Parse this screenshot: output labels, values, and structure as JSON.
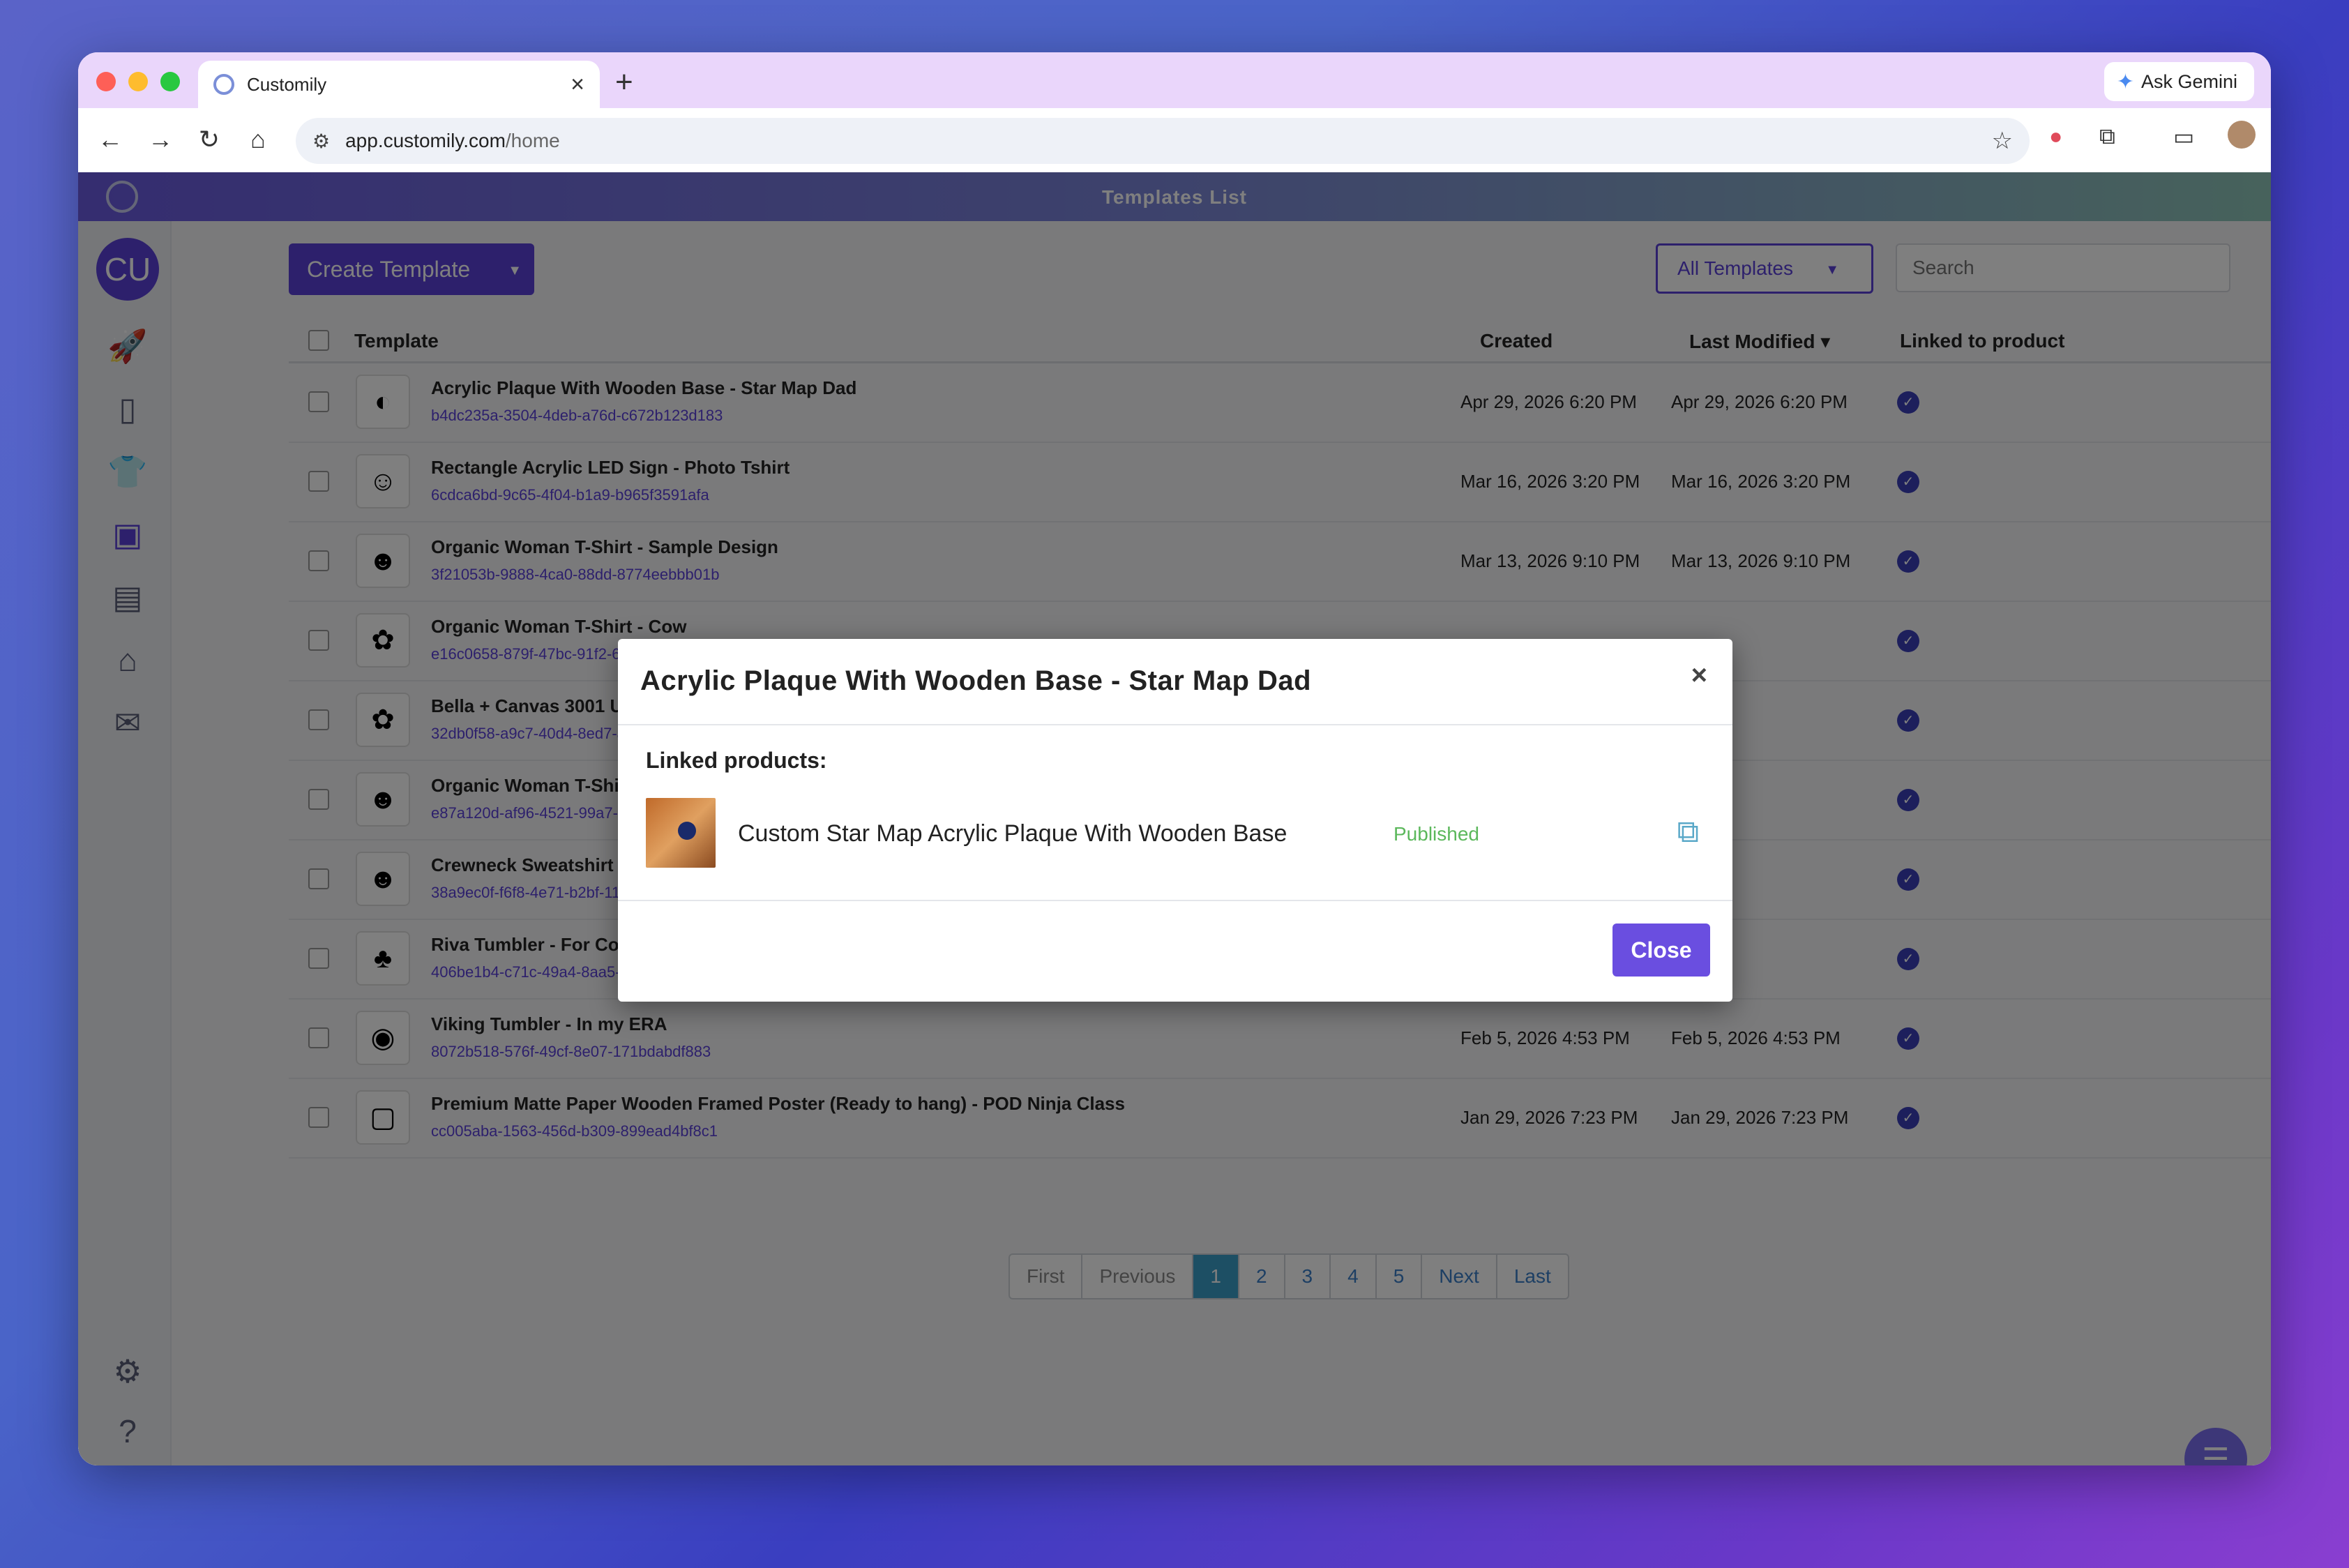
{
  "browser": {
    "tab_title": "Customily",
    "tab_close": "×",
    "new_tab": "+",
    "gemini_label": "Ask Gemini",
    "url_host": "app.customily.com",
    "url_path": "/home"
  },
  "app": {
    "header_title": "Templates List",
    "avatar_initials": "CU",
    "create_label": "Create Template",
    "filter_label": "All Templates",
    "search_placeholder": "Search",
    "columns": {
      "template": "Template",
      "created": "Created",
      "modified": "Last Modified ▾",
      "linked": "Linked to product"
    },
    "rows": [
      {
        "name": "Acrylic Plaque With Wooden Base - Star Map Dad",
        "id": "b4dc235a-3504-4deb-a76d-c672b123d183",
        "created": "Apr 29, 2026 6:20 PM",
        "modified": "Apr 29, 2026 6:20 PM"
      },
      {
        "name": "Rectangle Acrylic LED Sign - Photo Tshirt",
        "id": "6cdca6bd-9c65-4f04-b1a9-b965f3591afa",
        "created": "Mar 16, 2026 3:20 PM",
        "modified": "Mar 16, 2026 3:20 PM"
      },
      {
        "name": "Organic Woman T-Shirt - Sample Design",
        "id": "3f21053b-9888-4ca0-88dd-8774eebbb01b",
        "created": "Mar 13, 2026 9:10 PM",
        "modified": "Mar 13, 2026 9:10 PM"
      },
      {
        "name": "Organic Woman T-Shirt - Cow",
        "id": "e16c0658-879f-47bc-91f2-6aa1032",
        "created": "",
        "modified": ""
      },
      {
        "name": "Bella + Canvas 3001 Unisex T",
        "id": "32db0f58-a9c7-40d4-8ed7-ad9bb1",
        "created": "",
        "modified": ""
      },
      {
        "name": "Organic Woman T-Shirt - Pho",
        "id": "e87a120d-af96-4521-99a7-c75844",
        "created": "",
        "modified": ""
      },
      {
        "name": "Crewneck Sweatshirt - Photo",
        "id": "38a9ec0f-f6f8-4e71-b2bf-11beb114",
        "created": "",
        "modified": ""
      },
      {
        "name": "Riva Tumbler - For Couples",
        "id": "406be1b4-c71c-49a4-8aa5-3fc71c",
        "created": "",
        "modified": ""
      },
      {
        "name": "Viking Tumbler - In my ERA",
        "id": "8072b518-576f-49cf-8e07-171bdabdf883",
        "created": "Feb 5, 2026 4:53 PM",
        "modified": "Feb 5, 2026 4:53 PM"
      },
      {
        "name": "Premium Matte Paper Wooden Framed Poster (Ready to hang) - POD Ninja Class",
        "id": "cc005aba-1563-456d-b309-899ead4bf8c1",
        "created": "Jan 29, 2026 7:23 PM",
        "modified": "Jan 29, 2026 7:23 PM"
      }
    ],
    "pagination": [
      "First",
      "Previous",
      "1",
      "2",
      "3",
      "4",
      "5",
      "Next",
      "Last"
    ],
    "active_page": "1"
  },
  "modal": {
    "title": "Acrylic Plaque With Wooden Base - Star Map Dad",
    "close_x": "×",
    "linked_label": "Linked products:",
    "product_name": "Custom Star Map Acrylic Plaque With Wooden Base",
    "product_status": "Published",
    "close_button": "Close"
  },
  "colors": {
    "brand": "#5b40d8",
    "published": "#5cb85c",
    "link": "#3a7fc8"
  }
}
